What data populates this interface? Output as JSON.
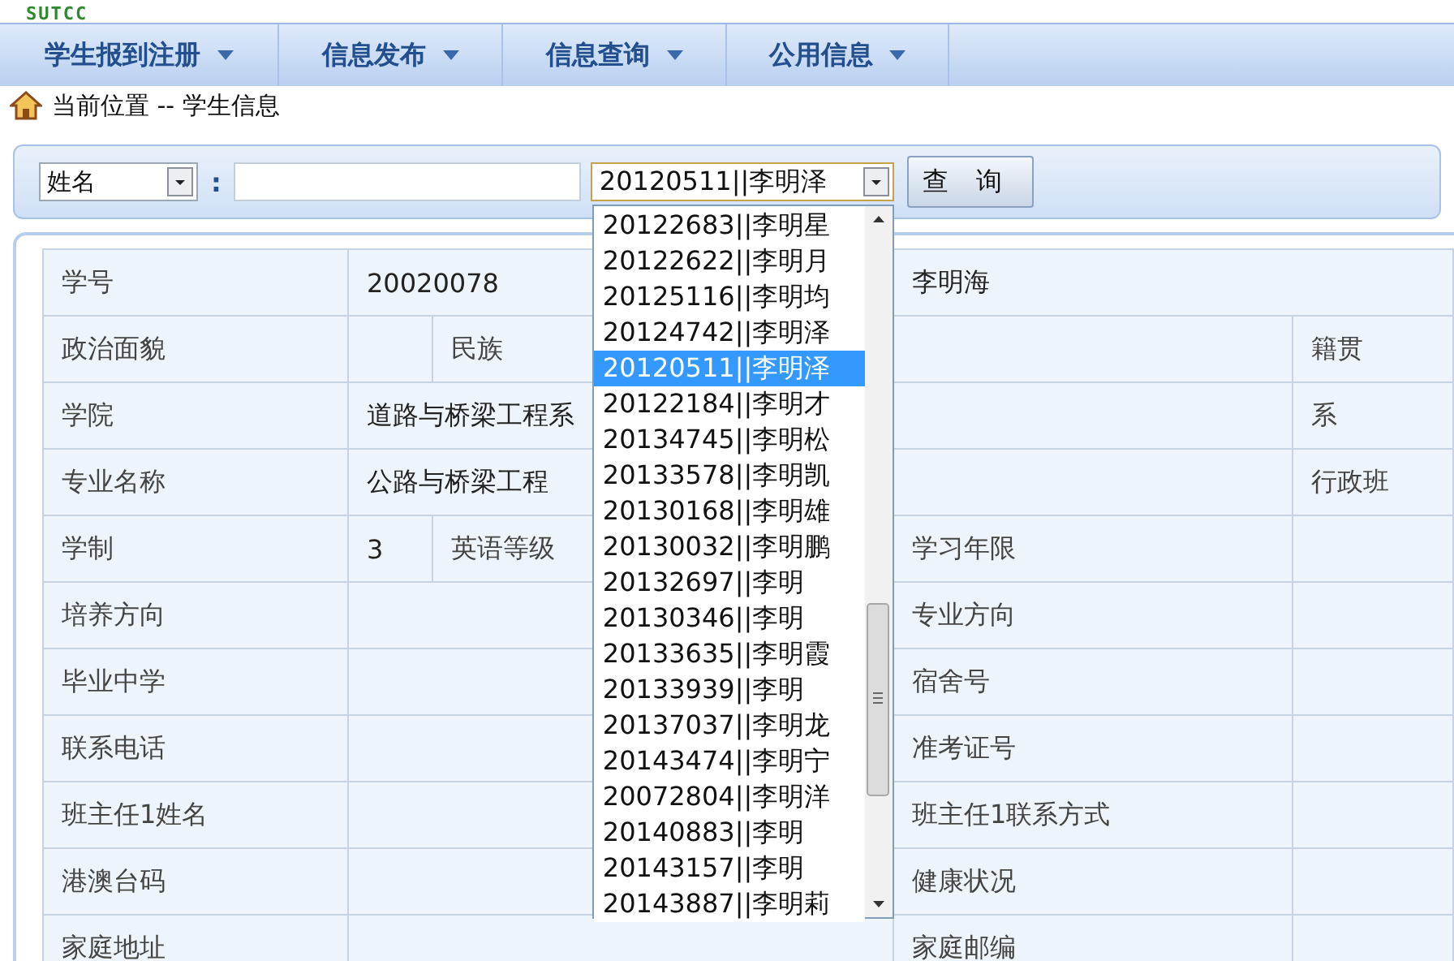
{
  "logo": "SUTCC",
  "nav": [
    {
      "label": "学生报到注册"
    },
    {
      "label": "信息发布"
    },
    {
      "label": "信息查询"
    },
    {
      "label": "公用信息"
    }
  ],
  "breadcrumb": "当前位置 -- 学生信息",
  "search": {
    "field_select": "姓名",
    "colon": ":",
    "result_select": "20120511||李明泽",
    "button": "查 询",
    "options": [
      {
        "label": "20122683||李明星",
        "selected": false
      },
      {
        "label": "20122622||李明月",
        "selected": false
      },
      {
        "label": "20125116||李明均",
        "selected": false
      },
      {
        "label": "20124742||李明泽",
        "selected": false
      },
      {
        "label": "20120511||李明泽",
        "selected": true
      },
      {
        "label": "20122184||李明才",
        "selected": false
      },
      {
        "label": "20134745||李明松",
        "selected": false
      },
      {
        "label": "20133578||李明凯",
        "selected": false
      },
      {
        "label": "20130168||李明雄",
        "selected": false
      },
      {
        "label": "20130032||李明鹏",
        "selected": false
      },
      {
        "label": "20132697||李明",
        "selected": false
      },
      {
        "label": "20130346||李明",
        "selected": false
      },
      {
        "label": "20133635||李明霞",
        "selected": false
      },
      {
        "label": "20133939||李明",
        "selected": false
      },
      {
        "label": "20137037||李明龙",
        "selected": false
      },
      {
        "label": "20143474||李明宁",
        "selected": false
      },
      {
        "label": "20072804||李明洋",
        "selected": false
      },
      {
        "label": "20140883||李明",
        "selected": false
      },
      {
        "label": "20143157||李明",
        "selected": false
      },
      {
        "label": "20143887||李明莉",
        "selected": false
      }
    ]
  },
  "table": {
    "rows": [
      {
        "kind": "id",
        "cells": [
          {
            "kind": "label",
            "text": "学号"
          },
          {
            "kind": "value",
            "text": "20020078"
          },
          {
            "kind": "value",
            "text": "李明海"
          }
        ]
      },
      {
        "kind": "pair",
        "cells": [
          {
            "kind": "label",
            "text": "政治面貌"
          },
          {
            "kind": "empty"
          },
          {
            "kind": "label",
            "text": "民族"
          },
          {
            "kind": "empty"
          },
          {
            "kind": "label",
            "text": "籍贯"
          }
        ]
      },
      {
        "kind": "wide",
        "cells": [
          {
            "kind": "label",
            "text": "学院"
          },
          {
            "kind": "value",
            "text": "道路与桥梁工程系"
          },
          {
            "kind": "label",
            "text": "系"
          }
        ]
      },
      {
        "kind": "wide",
        "cells": [
          {
            "kind": "label",
            "text": "专业名称"
          },
          {
            "kind": "value",
            "text": "公路与桥梁工程"
          },
          {
            "kind": "label",
            "text": "行政班"
          }
        ]
      },
      {
        "kind": "pair",
        "cells": [
          {
            "kind": "label",
            "text": "学制"
          },
          {
            "kind": "value",
            "text": "3"
          },
          {
            "kind": "label",
            "text": "英语等级"
          },
          {
            "kind": "label",
            "text": "学习年限"
          },
          {
            "kind": "empty"
          }
        ]
      },
      {
        "kind": "half",
        "cells": [
          {
            "kind": "label",
            "text": "培养方向"
          },
          {
            "kind": "empty"
          },
          {
            "kind": "label",
            "text": "专业方向"
          },
          {
            "kind": "empty"
          }
        ]
      },
      {
        "kind": "half",
        "cells": [
          {
            "kind": "label",
            "text": "毕业中学"
          },
          {
            "kind": "empty"
          },
          {
            "kind": "label",
            "text": "宿舍号"
          },
          {
            "kind": "empty"
          }
        ]
      },
      {
        "kind": "half",
        "cells": [
          {
            "kind": "label",
            "text": "联系电话"
          },
          {
            "kind": "empty"
          },
          {
            "kind": "label",
            "text": "准考证号"
          },
          {
            "kind": "empty"
          }
        ]
      },
      {
        "kind": "half",
        "cells": [
          {
            "kind": "label",
            "text": "班主任1姓名"
          },
          {
            "kind": "empty"
          },
          {
            "kind": "label",
            "text": "班主任1联系方式"
          },
          {
            "kind": "empty"
          }
        ]
      },
      {
        "kind": "half",
        "cells": [
          {
            "kind": "label",
            "text": "港澳台码"
          },
          {
            "kind": "empty"
          },
          {
            "kind": "label",
            "text": "健康状况"
          },
          {
            "kind": "empty"
          }
        ]
      },
      {
        "kind": "half",
        "cells": [
          {
            "kind": "label",
            "text": "家庭地址"
          },
          {
            "kind": "empty"
          },
          {
            "kind": "label",
            "text": "家庭邮编"
          },
          {
            "kind": "empty"
          }
        ]
      }
    ]
  }
}
